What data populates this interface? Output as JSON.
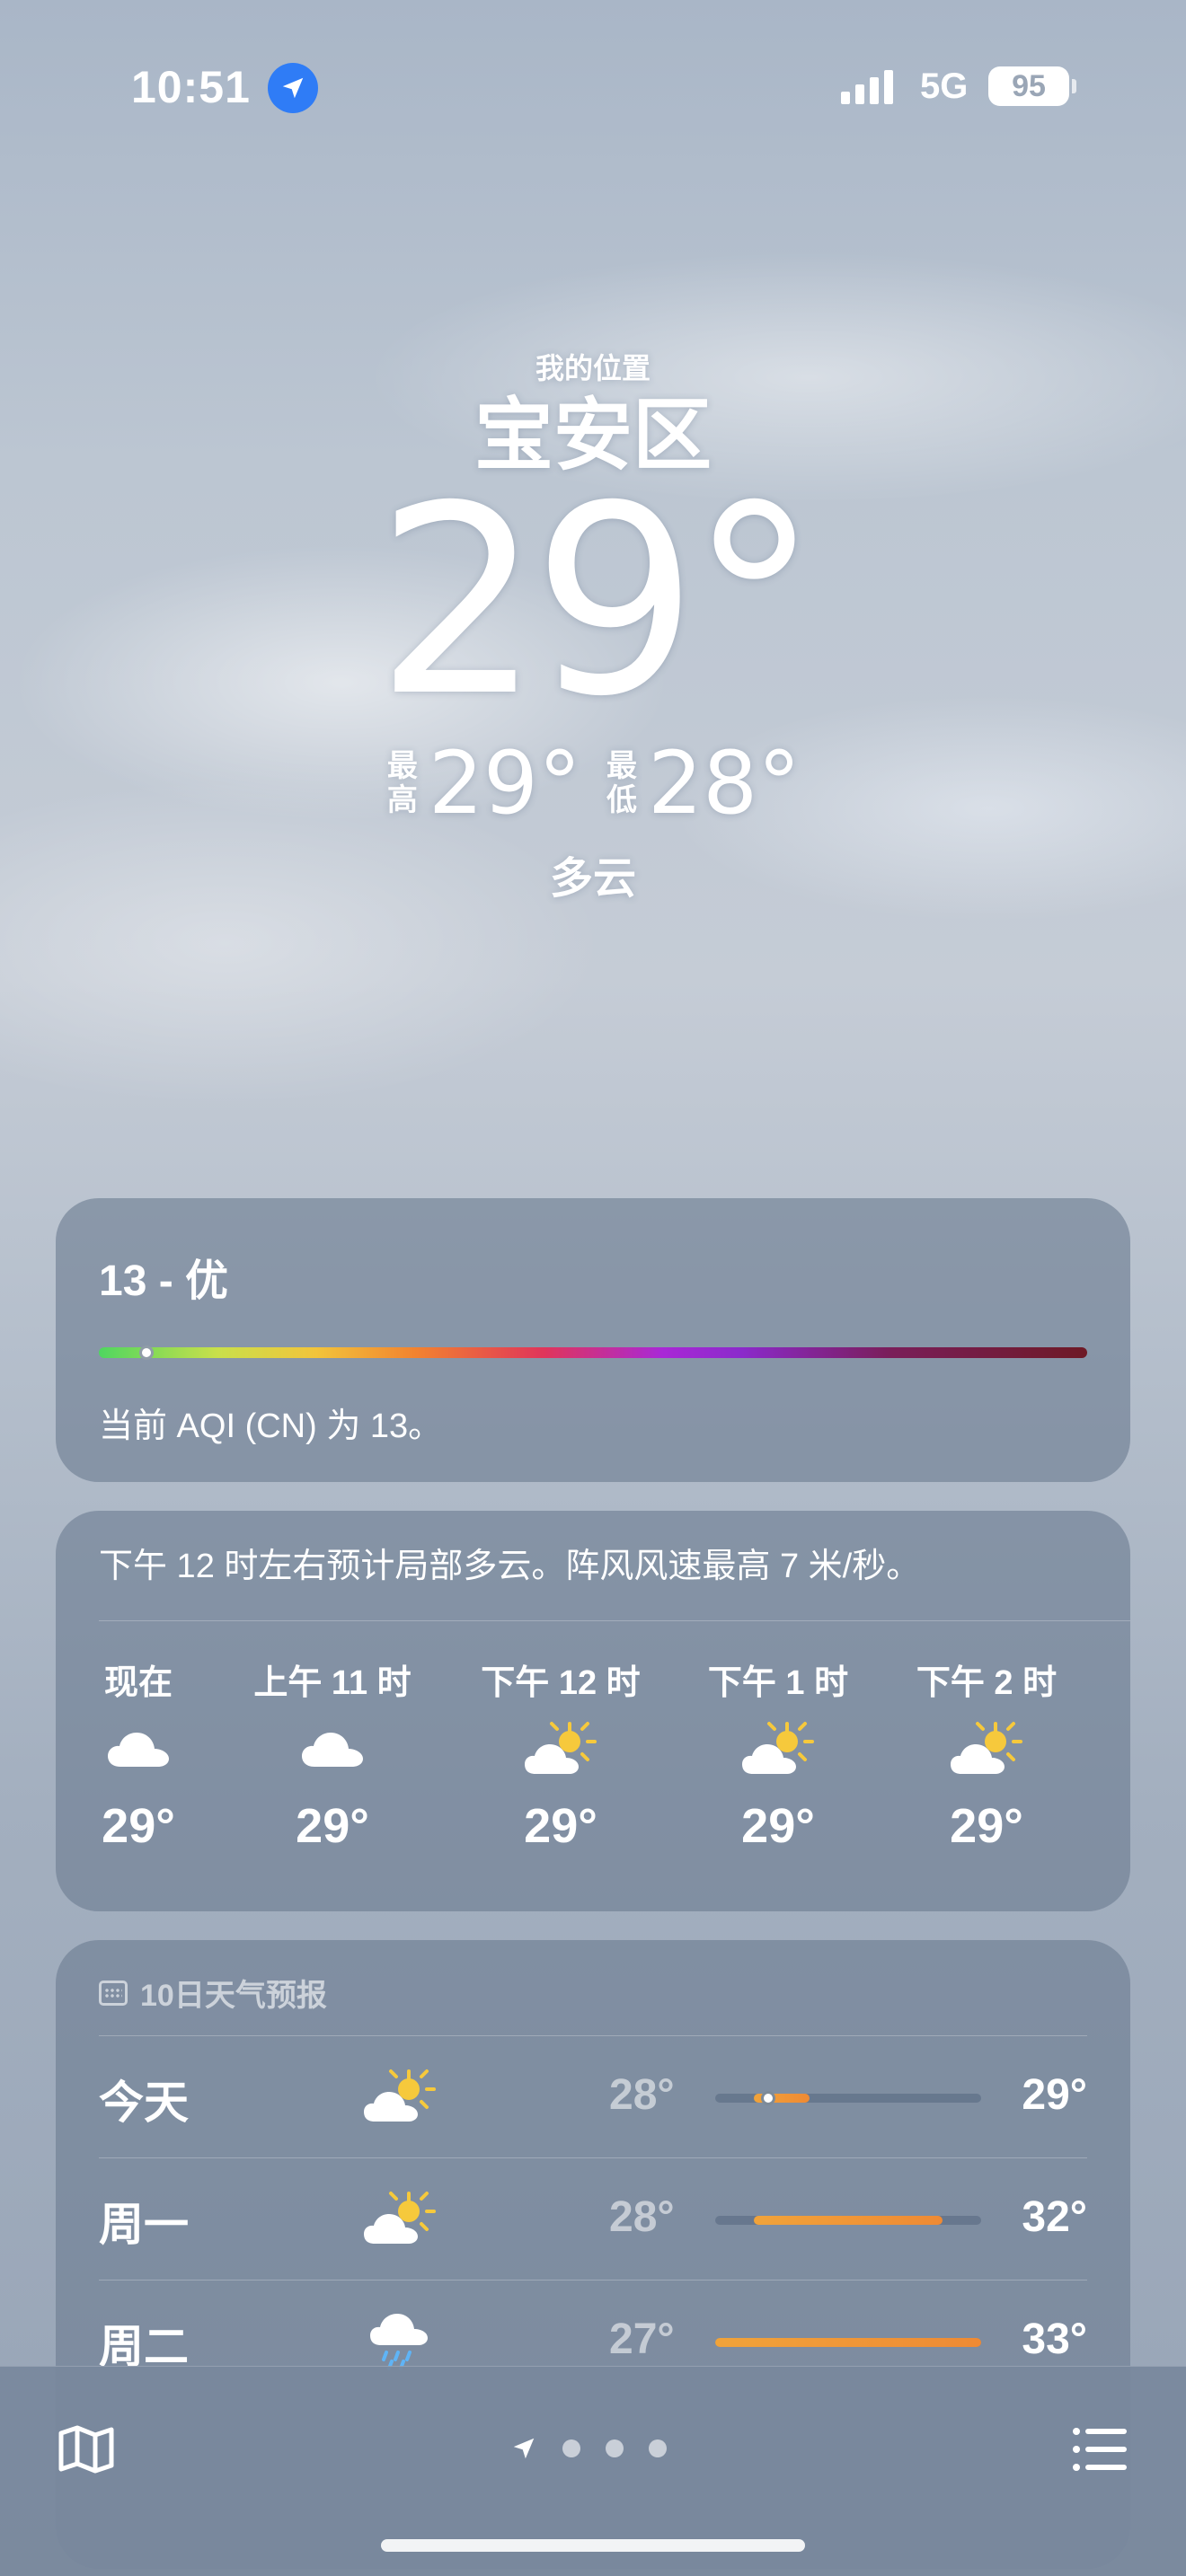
{
  "status_bar": {
    "time": "10:51",
    "network": "5G",
    "battery": "95"
  },
  "header": {
    "location_label": "我的位置",
    "city": "宝安区",
    "temperature": "29°",
    "high_label": "最高",
    "high": "29°",
    "low_label": "最低",
    "low": "28°",
    "condition": "多云"
  },
  "aqi": {
    "title": "13 - 优",
    "description": "当前 AQI (CN) 为 13。",
    "value": 13
  },
  "hourly": {
    "summary": "下午 12 时左右预计局部多云。阵风风速最高 7 米/秒。",
    "items": [
      {
        "label": "现在",
        "icon": "cloud-icon",
        "temp": "29°"
      },
      {
        "label": "上午 11 时",
        "icon": "cloud-icon",
        "temp": "29°"
      },
      {
        "label": "下午 12 时",
        "icon": "partly-sunny-icon",
        "temp": "29°"
      },
      {
        "label": "下午 1 时",
        "icon": "partly-sunny-icon",
        "temp": "29°"
      },
      {
        "label": "下午 2 时",
        "icon": "partly-sunny-icon",
        "temp": "29°"
      }
    ]
  },
  "daily": {
    "header": "10日天气预报",
    "range": {
      "min": 27,
      "max": 33
    },
    "days": [
      {
        "name": "今天",
        "icon": "partly-sunny-icon",
        "low": "28°",
        "high": "29°",
        "low_val": 28,
        "high_val": 29,
        "current": 29
      },
      {
        "name": "周一",
        "icon": "partly-sunny-icon",
        "low": "28°",
        "high": "32°",
        "low_val": 28,
        "high_val": 32
      },
      {
        "name": "周二",
        "icon": "rain-cloud-icon",
        "low": "27°",
        "high": "33°",
        "low_val": 27,
        "high_val": 33
      }
    ]
  },
  "colors": {
    "accent_blue": "#2f7cf6",
    "bar_orange": "#ef8a34",
    "sun_yellow": "#f6c93c"
  }
}
